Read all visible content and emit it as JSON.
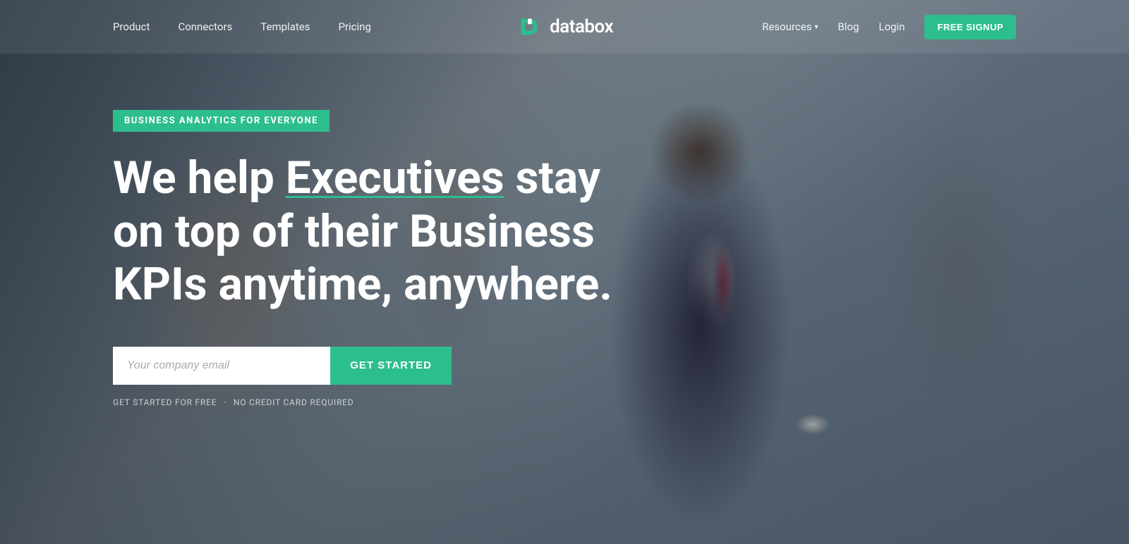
{
  "brand": {
    "logo_text": "databox",
    "logo_icon_alt": "databox-logo"
  },
  "nav": {
    "left_links": [
      {
        "label": "Product",
        "id": "product"
      },
      {
        "label": "Connectors",
        "id": "connectors"
      },
      {
        "label": "Templates",
        "id": "templates"
      },
      {
        "label": "Pricing",
        "id": "pricing"
      }
    ],
    "right_links": [
      {
        "label": "Resources",
        "id": "resources",
        "has_dropdown": true
      },
      {
        "label": "Blog",
        "id": "blog"
      },
      {
        "label": "Login",
        "id": "login"
      }
    ],
    "cta_button": "FREE SIGNUP"
  },
  "hero": {
    "badge": "BUSINESS ANALYTICS FOR EVERYONE",
    "headline_part1": "We help ",
    "headline_highlight": "Executives",
    "headline_part2": " stay on top of their Business KPIs anytime, anywhere.",
    "email_placeholder": "Your company email",
    "cta_button": "GET STARTED",
    "subtext_part1": "GET STARTED FOR FREE",
    "subtext_separator": "·",
    "subtext_part2": "NO CREDIT CARD REQUIRED"
  },
  "colors": {
    "accent": "#2dbe8e",
    "white": "#ffffff",
    "dark_overlay": "rgba(20,30,40,0.65)"
  }
}
